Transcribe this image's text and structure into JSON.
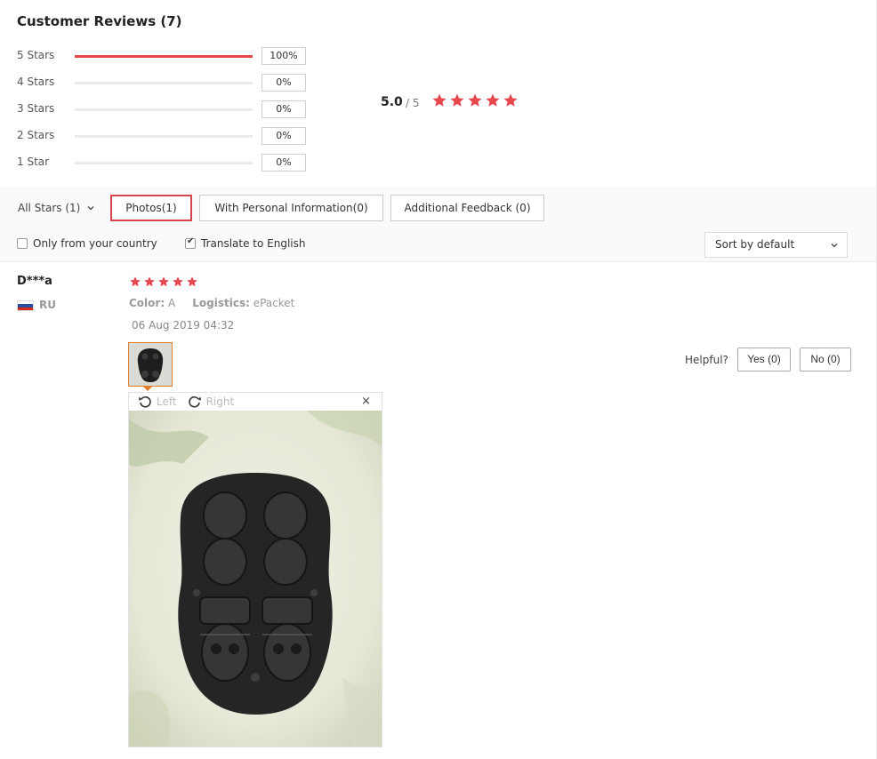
{
  "title": "Customer Reviews (7)",
  "distribution": [
    {
      "label": "5 Stars",
      "percent_label": "100%",
      "fraction": 1.0
    },
    {
      "label": "4 Stars",
      "percent_label": "0%",
      "fraction": 0.0
    },
    {
      "label": "3 Stars",
      "percent_label": "0%",
      "fraction": 0.0
    },
    {
      "label": "2 Stars",
      "percent_label": "0%",
      "fraction": 0.0
    },
    {
      "label": "1 Star",
      "percent_label": "0%",
      "fraction": 0.0
    }
  ],
  "average": {
    "value": "5.0",
    "max": "/ 5",
    "stars": 5
  },
  "filters": {
    "all_stars": "All Stars (1)",
    "photos": "Photos(1)",
    "personal": "With Personal Information(0)",
    "additional": "Additional Feedback (0)"
  },
  "options": {
    "only_country": {
      "label": "Only from your country",
      "checked": false
    },
    "translate": {
      "label": "Translate to English",
      "checked": true
    }
  },
  "sort": {
    "label": "Sort by default"
  },
  "review": {
    "reviewer": "D***a",
    "country": "RU",
    "stars": 5,
    "color_label": "Color:",
    "color_value": "A",
    "logistics_label": "Logistics:",
    "logistics_value": "ePacket",
    "date": "06 Aug 2019 04:32",
    "helpful_label": "Helpful?",
    "yes_label": "Yes (0)",
    "no_label": "No (0)",
    "viewer": {
      "left": "Left",
      "right": "Right",
      "close": "×"
    }
  },
  "colors": {
    "accent": "#e5474f",
    "active_border": "#d6454d",
    "thumb_border": "#e07c2e"
  }
}
